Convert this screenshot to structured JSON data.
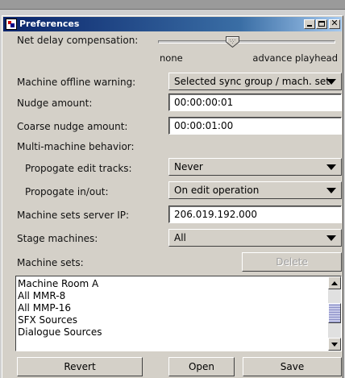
{
  "window": {
    "title": "Preferences",
    "close_glyph": "✕"
  },
  "net_delay": {
    "label": "Net delay compensation:",
    "min_label": "none",
    "max_label": "advance playhead",
    "value_fraction": 0.42
  },
  "machine_offline": {
    "label": "Machine offline warning:",
    "value": "Selected sync group / mach. set"
  },
  "nudge": {
    "label": "Nudge amount:",
    "value": "00:00:00:01"
  },
  "coarse_nudge": {
    "label": "Coarse nudge amount:",
    "value": "00:00:01:00"
  },
  "multi_machine": {
    "label": "Multi-machine behavior:",
    "edit_tracks": {
      "label": "Propogate edit tracks:",
      "value": "Never"
    },
    "in_out": {
      "label": "Propogate in/out:",
      "value": "On edit operation"
    }
  },
  "server_ip": {
    "label": "Machine sets server IP:",
    "value": "206.019.192.000"
  },
  "stage_machines": {
    "label": "Stage machines:",
    "value": "All"
  },
  "machine_sets": {
    "label": "Machine sets:",
    "delete_label": "Delete",
    "items": [
      "Machine Room A",
      "All MMR-8",
      "All MMP-16",
      "SFX Sources",
      "Dialogue Sources"
    ]
  },
  "buttons": {
    "revert": "Revert",
    "open": "Open",
    "save": "Save"
  }
}
